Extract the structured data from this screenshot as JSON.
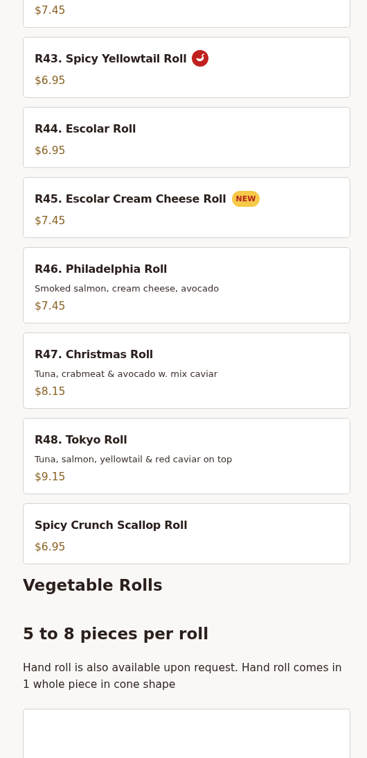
{
  "items": [
    {
      "kind": "cut",
      "price": "$7.45"
    },
    {
      "kind": "item",
      "name": "R43. Spicy Yellowtail Roll",
      "tags": [
        {
          "kind": "spicy"
        }
      ],
      "price": "$6.95"
    },
    {
      "kind": "item",
      "name": "R44. Escolar Roll",
      "price": "$6.95"
    },
    {
      "kind": "item",
      "name": "R45. Escolar Cream Cheese Roll",
      "tags": [
        {
          "kind": "badge",
          "text": "NEW"
        }
      ],
      "price": "$7.45"
    },
    {
      "kind": "item",
      "name": "R46. Philadelphia Roll",
      "description": "Smoked salmon, cream cheese, avocado",
      "price": "$7.45"
    },
    {
      "kind": "item",
      "name": "R47. Christmas Roll",
      "description": "Tuna, crabmeat & avocado w. mix caviar",
      "price": "$8.15"
    },
    {
      "kind": "item",
      "name": "R48. Tokyo Roll",
      "description": "Tuna, salmon, yellowtail & red caviar on top",
      "price": "$9.15"
    },
    {
      "kind": "item",
      "name": "Spicy Crunch Scallop Roll",
      "price": "$6.95"
    }
  ],
  "section": {
    "title": "Vegetable Rolls",
    "subtitle": "5 to 8 pieces per roll",
    "note": "Hand roll is also available upon request. Hand roll comes in 1 whole piece in cone shape"
  },
  "next_items": [
    {
      "kind": "empty"
    }
  ]
}
